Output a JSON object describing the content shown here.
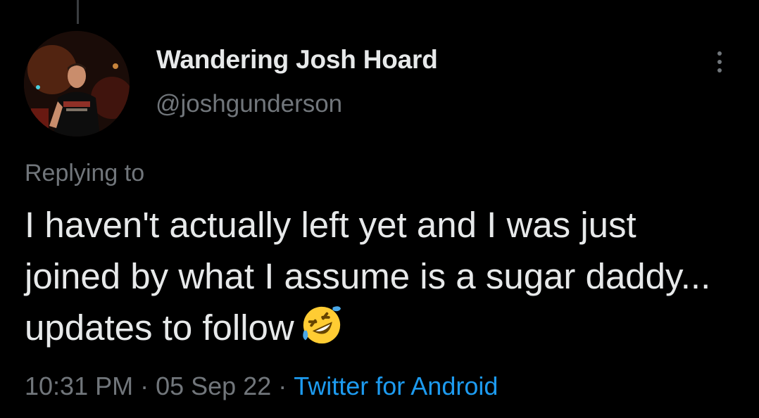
{
  "tweet": {
    "author": {
      "display_name": "Wandering Josh Hoard",
      "handle": "@joshgunderson",
      "avatar": "profile-photo"
    },
    "replying_to_label": "Replying to",
    "text": "I haven't actually left yet and I was just joined by what I assume is a sugar daddy... updates to follow",
    "emoji": "rolling-on-the-floor-laughing-emoji",
    "meta": {
      "time": "10:31 PM",
      "separator": "·",
      "date": "05 Sep 22",
      "source": "Twitter for Android"
    },
    "more_icon": "more-options-icon"
  },
  "colors": {
    "background": "#000000",
    "primary_text": "#e7e9ea",
    "secondary_text": "#71767b",
    "link": "#1d9bf0"
  }
}
